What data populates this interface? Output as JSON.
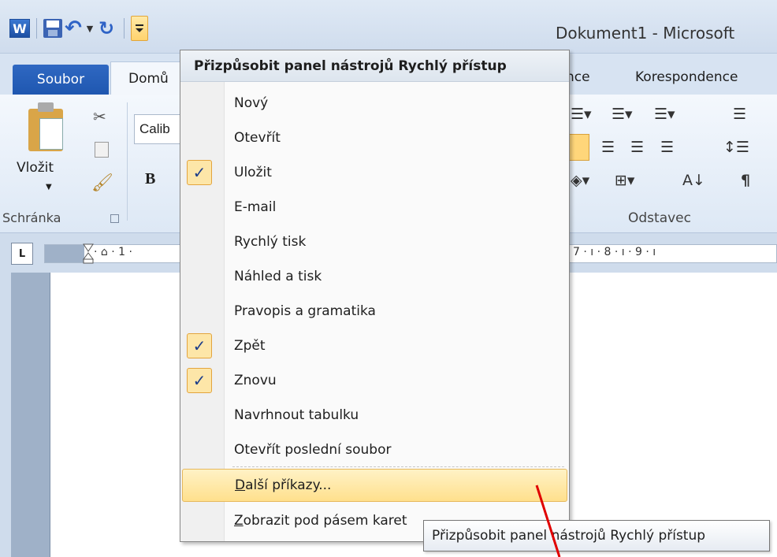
{
  "title_bar": {
    "document_title": "Dokument1 - Microsoft",
    "qat_icons": [
      "word-icon",
      "save-icon",
      "undo-icon",
      "undo-dropdown-icon",
      "redo-icon",
      "customize-qat-icon"
    ],
    "word_letter": "W"
  },
  "tabs": {
    "file": "Soubor",
    "home": "Domů",
    "references_partial": "nce",
    "mailings": "Korespondence"
  },
  "ribbon": {
    "paste_label": "Vložit",
    "font_name": "Calib",
    "bold_glyph": "B",
    "clipboard_group": "Schránka",
    "paragraph_group": "Odstavec",
    "sort_glyph": "A↓",
    "pilcrow_glyph": "¶"
  },
  "ruler": {
    "button_glyph": "L",
    "left_marks": "· ⌂ · 1 ·",
    "right_marks": "7 · ı · 8 · ı · 9 · ı"
  },
  "menu": {
    "header": "Přizpůsobit panel nástrojů Rychlý přístup",
    "items": [
      {
        "label": "Nový",
        "checked": false
      },
      {
        "label": "Otevřít",
        "checked": false
      },
      {
        "label": "Uložit",
        "checked": true
      },
      {
        "label": "E-mail",
        "checked": false
      },
      {
        "label": "Rychlý tisk",
        "checked": false
      },
      {
        "label": "Náhled a tisk",
        "checked": false
      },
      {
        "label": "Pravopis a gramatika",
        "checked": false
      },
      {
        "label": "Zpět",
        "checked": true
      },
      {
        "label": "Znovu",
        "checked": true
      },
      {
        "label": "Navrhnout tabulku",
        "checked": false
      },
      {
        "label": "Otevřít poslední soubor",
        "checked": false
      }
    ],
    "more_commands_first": "D",
    "more_commands_rest": "alší příkazy...",
    "show_below_first": "Z",
    "show_below_rest": "obrazit pod pásem karet",
    "check_glyph": "✓"
  },
  "tooltip": {
    "text": "Přizpůsobit panel nástrojů Rychlý přístup"
  },
  "colors": {
    "accent_blue": "#2f68c2",
    "highlight": "#ffe08d",
    "annotation_red": "#e00000"
  }
}
